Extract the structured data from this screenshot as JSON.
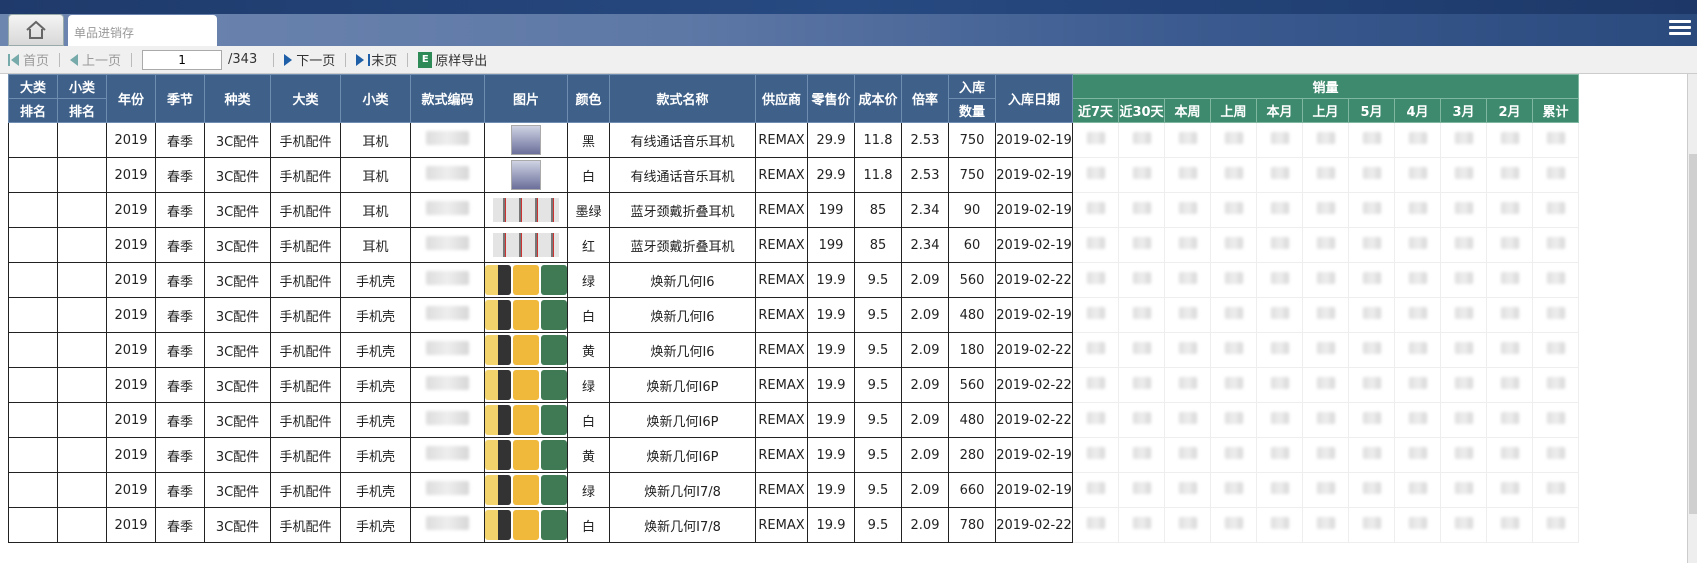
{
  "tab_title": "单品进销存",
  "pager": {
    "first": "首页",
    "prev": "上一页",
    "page": "1",
    "total": "/343",
    "next": "下一页",
    "last": "末页",
    "export": "原样导出"
  },
  "headers": {
    "big_rank_top": "大类",
    "big_rank_bot": "排名",
    "small_rank_top": "小类",
    "small_rank_bot": "排名",
    "year": "年份",
    "season": "季节",
    "kind": "种类",
    "big": "大类",
    "small": "小类",
    "code": "款式编码",
    "pic": "图片",
    "color": "颜色",
    "name": "款式名称",
    "supplier": "供应商",
    "retail": "零售价",
    "cost": "成本价",
    "ratio": "倍率",
    "stock_top": "入库",
    "stock_bot": "数量",
    "date": "入库日期",
    "sales": "销量",
    "sales_cols": [
      "近7天",
      "近30天",
      "本周",
      "上周",
      "本月",
      "上月",
      "5月",
      "4月",
      "3月",
      "2月",
      "累计"
    ]
  },
  "rows": [
    {
      "year": "2019",
      "season": "春季",
      "kind": "3C配件",
      "big": "手机配件",
      "small": "耳机",
      "pic": "earphone",
      "color": "黑",
      "name": "有线通话音乐耳机",
      "supplier": "REMAX",
      "retail": "29.9",
      "cost": "11.8",
      "ratio": "2.53",
      "qty": "750",
      "date": "2019-02-19"
    },
    {
      "year": "2019",
      "season": "春季",
      "kind": "3C配件",
      "big": "手机配件",
      "small": "耳机",
      "pic": "earphone",
      "color": "白",
      "name": "有线通话音乐耳机",
      "supplier": "REMAX",
      "retail": "29.9",
      "cost": "11.8",
      "ratio": "2.53",
      "qty": "750",
      "date": "2019-02-19"
    },
    {
      "year": "2019",
      "season": "春季",
      "kind": "3C配件",
      "big": "手机配件",
      "small": "耳机",
      "pic": "headset",
      "color": "墨绿",
      "name": "蓝牙颈戴折叠耳机",
      "supplier": "REMAX",
      "retail": "199",
      "cost": "85",
      "ratio": "2.34",
      "qty": "90",
      "date": "2019-02-19"
    },
    {
      "year": "2019",
      "season": "春季",
      "kind": "3C配件",
      "big": "手机配件",
      "small": "耳机",
      "pic": "headset",
      "color": "红",
      "name": "蓝牙颈戴折叠耳机",
      "supplier": "REMAX",
      "retail": "199",
      "cost": "85",
      "ratio": "2.34",
      "qty": "60",
      "date": "2019-02-19"
    },
    {
      "year": "2019",
      "season": "春季",
      "kind": "3C配件",
      "big": "手机配件",
      "small": "手机壳",
      "pic": "case",
      "color": "绿",
      "name": "焕新几何I6",
      "supplier": "REMAX",
      "retail": "19.9",
      "cost": "9.5",
      "ratio": "2.09",
      "qty": "560",
      "date": "2019-02-22"
    },
    {
      "year": "2019",
      "season": "春季",
      "kind": "3C配件",
      "big": "手机配件",
      "small": "手机壳",
      "pic": "case",
      "color": "白",
      "name": "焕新几何I6",
      "supplier": "REMAX",
      "retail": "19.9",
      "cost": "9.5",
      "ratio": "2.09",
      "qty": "480",
      "date": "2019-02-19"
    },
    {
      "year": "2019",
      "season": "春季",
      "kind": "3C配件",
      "big": "手机配件",
      "small": "手机壳",
      "pic": "case",
      "color": "黄",
      "name": "焕新几何I6",
      "supplier": "REMAX",
      "retail": "19.9",
      "cost": "9.5",
      "ratio": "2.09",
      "qty": "180",
      "date": "2019-02-22"
    },
    {
      "year": "2019",
      "season": "春季",
      "kind": "3C配件",
      "big": "手机配件",
      "small": "手机壳",
      "pic": "case",
      "color": "绿",
      "name": "焕新几何I6P",
      "supplier": "REMAX",
      "retail": "19.9",
      "cost": "9.5",
      "ratio": "2.09",
      "qty": "560",
      "date": "2019-02-22"
    },
    {
      "year": "2019",
      "season": "春季",
      "kind": "3C配件",
      "big": "手机配件",
      "small": "手机壳",
      "pic": "case",
      "color": "白",
      "name": "焕新几何I6P",
      "supplier": "REMAX",
      "retail": "19.9",
      "cost": "9.5",
      "ratio": "2.09",
      "qty": "480",
      "date": "2019-02-22"
    },
    {
      "year": "2019",
      "season": "春季",
      "kind": "3C配件",
      "big": "手机配件",
      "small": "手机壳",
      "pic": "case",
      "color": "黄",
      "name": "焕新几何I6P",
      "supplier": "REMAX",
      "retail": "19.9",
      "cost": "9.5",
      "ratio": "2.09",
      "qty": "280",
      "date": "2019-02-19"
    },
    {
      "year": "2019",
      "season": "春季",
      "kind": "3C配件",
      "big": "手机配件",
      "small": "手机壳",
      "pic": "case",
      "color": "绿",
      "name": "焕新几何I7/8",
      "supplier": "REMAX",
      "retail": "19.9",
      "cost": "9.5",
      "ratio": "2.09",
      "qty": "660",
      "date": "2019-02-19"
    },
    {
      "year": "2019",
      "season": "春季",
      "kind": "3C配件",
      "big": "手机配件",
      "small": "手机壳",
      "pic": "case",
      "color": "白",
      "name": "焕新几何I7/8",
      "supplier": "REMAX",
      "retail": "19.9",
      "cost": "9.5",
      "ratio": "2.09",
      "qty": "780",
      "date": "2019-02-22"
    }
  ]
}
